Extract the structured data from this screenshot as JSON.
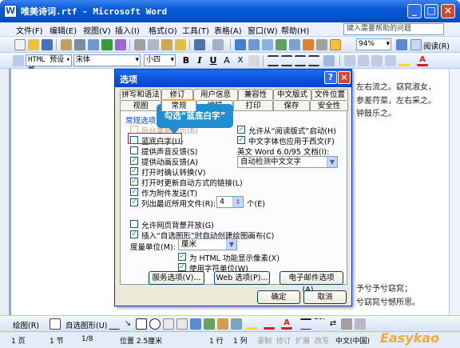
{
  "window": {
    "title": "唯美诗词.rtf - Microsoft Word",
    "min": "_",
    "max": "□",
    "close": "×"
  },
  "menu": {
    "items": [
      "文件(F)",
      "编辑(E)",
      "视图(V)",
      "插入(I)",
      "格式(O)",
      "工具(T)",
      "表格(A)",
      "窗口(W)",
      "帮助(H)"
    ],
    "help_placeholder": "键入需要帮助的问题"
  },
  "toolbar": {
    "zoom": "94%",
    "read_label": "阅读(R)",
    "style": "HTML 预设格",
    "font": "宋体",
    "size": "小四"
  },
  "document": {
    "lines": [
      "左右流之。窈窕淑女，",
      "参差荇菜，左右采之。",
      "钟鼓乐之。"
    ],
    "bottom_lines": [
      "予兮予兮窈窕；",
      "兮窈窕兮憾所思。"
    ]
  },
  "dialog": {
    "title": "选项",
    "help": "?",
    "close": "×",
    "tabs_row1": [
      "拼写和语法",
      "修订",
      "用户信息",
      "兼容性",
      "中文版式",
      "文件位置"
    ],
    "tabs_row2": [
      "视图",
      "常规",
      "编辑",
      "打印",
      "保存",
      "安全性"
    ],
    "section": "常规选项",
    "left_options": [
      {
        "label": "后台重新分页(B)",
        "checked": false,
        "disabled": true
      },
      {
        "label": "蓝底白字(U)",
        "checked": false,
        "disabled": false
      },
      {
        "label": "提供声音反馈(S)",
        "checked": false,
        "disabled": false
      },
      {
        "label": "提供动画反馈(A)",
        "checked": true,
        "disabled": false
      },
      {
        "label": "打开时确认转换(V)",
        "checked": true,
        "disabled": false
      },
      {
        "label": "打开时更新自动方式的链接(L)",
        "checked": true,
        "disabled": false
      },
      {
        "label": "作为附件发送(T)",
        "checked": true,
        "disabled": false
      },
      {
        "label": "列出最近所用文件(R):",
        "checked": true,
        "disabled": false
      }
    ],
    "recent_count": "4",
    "recent_unit": "个(E)",
    "right_options": [
      {
        "label": "允许从“阅读版式”启动(H)",
        "checked": true
      },
      {
        "label": "中文字体也应用于西文(F)",
        "checked": true
      }
    ],
    "word_format_label": "英文 Word 6.0/95 文档(I):",
    "word_format_value": "自动检测中文文字",
    "lower_options": [
      {
        "label": "允许网页背景开放(G)",
        "checked": false
      },
      {
        "label": "插入“自选图形”时自动创建绘图画布(C)",
        "checked": true
      }
    ],
    "measure_label": "度量单位(M):",
    "measure_value": "厘米",
    "sub_options": [
      {
        "label": "为 HTML 功能显示像素(X)",
        "checked": true
      },
      {
        "label": "使用字符单位(W)",
        "checked": true
      }
    ],
    "buttons": [
      "服务选项(V)...",
      "Web 选项(P)...",
      "电子邮件选项(A)..."
    ],
    "ok": "确定",
    "cancel": "取消"
  },
  "callout": "勾选“蓝底白字”",
  "drawbar": {
    "draw": "绘图(R)",
    "autoshape": "自选图形(U)"
  },
  "status": {
    "page": "1 页",
    "section": "1 节",
    "pages": "1/8",
    "pos": "位置 2.5厘米",
    "line": "1 行",
    "col": "1 列",
    "rec": "录制",
    "trk": "修订",
    "ext": "扩展",
    "ovr": "改写",
    "lang": "中文(中国)"
  },
  "watermark": "Easykao"
}
